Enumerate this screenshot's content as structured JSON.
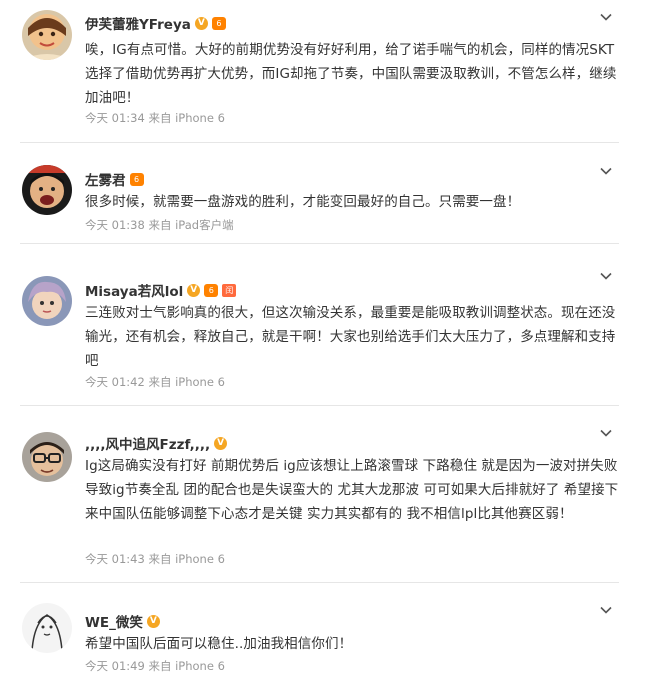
{
  "posts": [
    {
      "name": "伊芙蕾雅YFreya",
      "verified": "V",
      "level": "6",
      "extra": "",
      "text": "唉，IG有点可惜。大好的前期优势没有好好利用，给了诺手喘气的机会，同样的情况SKT选择了借助优势再扩大优势，而IG却拖了节奏，中国队需要汲取教训，不管怎么样，继续加油吧！",
      "meta": "今天 01:34 来自 iPhone 6"
    },
    {
      "name": "左雾君",
      "verified": "",
      "level": "6",
      "extra": "",
      "text": "很多时候，就需要一盘游戏的胜利，才能变回最好的自己。只需要一盘！",
      "meta": "今天 01:38 来自 iPad客户端"
    },
    {
      "name": "Misaya若风lol",
      "verified": "V",
      "level": "6",
      "extra": "闰",
      "text": "三连败对士气影响真的很大，但这次输没关系，最重要是能吸取教训调整状态。现在还没输光，还有机会，释放自己，就是干啊！大家也别给选手们太大压力了，多点理解和支持吧",
      "meta": "今天 01:42 来自 iPhone 6"
    },
    {
      "name": ",,,,风中追风Fzzf,,,,",
      "verified": "V",
      "level": "",
      "extra": "",
      "text": "Ig这局确实没有打好 前期优势后 ig应该想让上路滚雪球 下路稳住 就是因为一波对拼失败导致ig节奏全乱 团的配合也是失误蛮大的 尤其大龙那波 可可如果大后排就好了 希望接下来中国队伍能够调整下心态才是关键 实力其实都有的 我不相信lpl比其他赛区弱！",
      "meta": "今天 01:43 来自 iPhone 6"
    },
    {
      "name": "WE_微笑",
      "verified": "V",
      "level": "",
      "extra": "",
      "text": "希望中国队后面可以稳住..加油我相信你们！",
      "meta": "今天 01:49 来自 iPhone 6"
    }
  ],
  "colors": {
    "name": "#333333",
    "text": "#333333",
    "meta": "#999999",
    "verified": "#f5a623",
    "divider": "#e6e6e6"
  },
  "icons": {
    "chevron": "chevron-down-icon"
  }
}
